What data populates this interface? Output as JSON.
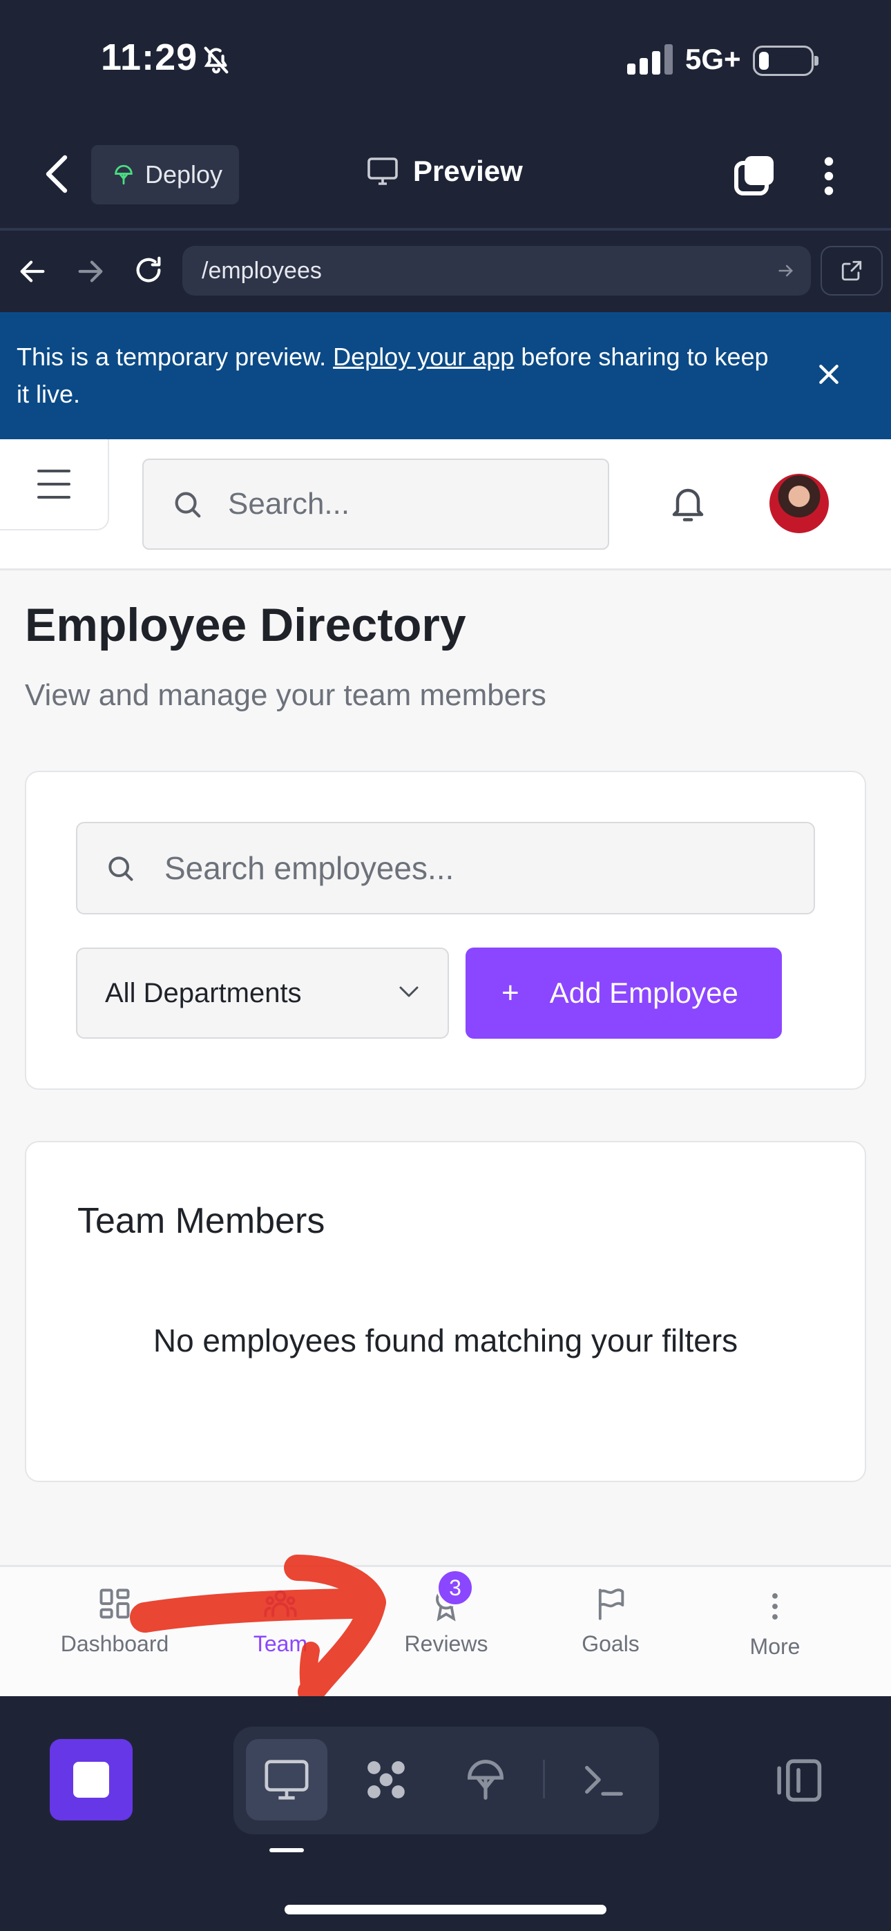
{
  "status_bar": {
    "time": "11:29",
    "network": "5G+"
  },
  "app_bar": {
    "deploy_label": "Deploy",
    "preview_label": "Preview"
  },
  "browser": {
    "url": "/employees"
  },
  "banner": {
    "text_before": "This is a temporary preview. ",
    "link": "Deploy your app",
    "text_after": " before sharing to keep it live."
  },
  "header": {
    "search_placeholder": "Search..."
  },
  "page": {
    "title": "Employee Directory",
    "subtitle": "View and manage your team members"
  },
  "filters": {
    "search_placeholder": "Search employees...",
    "department_selected": "All Departments",
    "add_button_icon": "+",
    "add_button_label": "Add Employee"
  },
  "members": {
    "title": "Team Members",
    "empty_message": "No employees found matching your filters"
  },
  "bottom_nav": {
    "items": [
      {
        "label": "Dashboard",
        "icon": "dashboard-icon"
      },
      {
        "label": "Team",
        "icon": "team-icon",
        "active": true
      },
      {
        "label": "Reviews",
        "icon": "award-icon",
        "badge": "3"
      },
      {
        "label": "Goals",
        "icon": "flag-icon"
      },
      {
        "label": "More",
        "icon": "more-vertical-icon"
      }
    ]
  },
  "colors": {
    "accent": "#8b46ff",
    "banner": "#0b4a86",
    "chrome": "#1e2436",
    "annotation": "#e8331e"
  }
}
